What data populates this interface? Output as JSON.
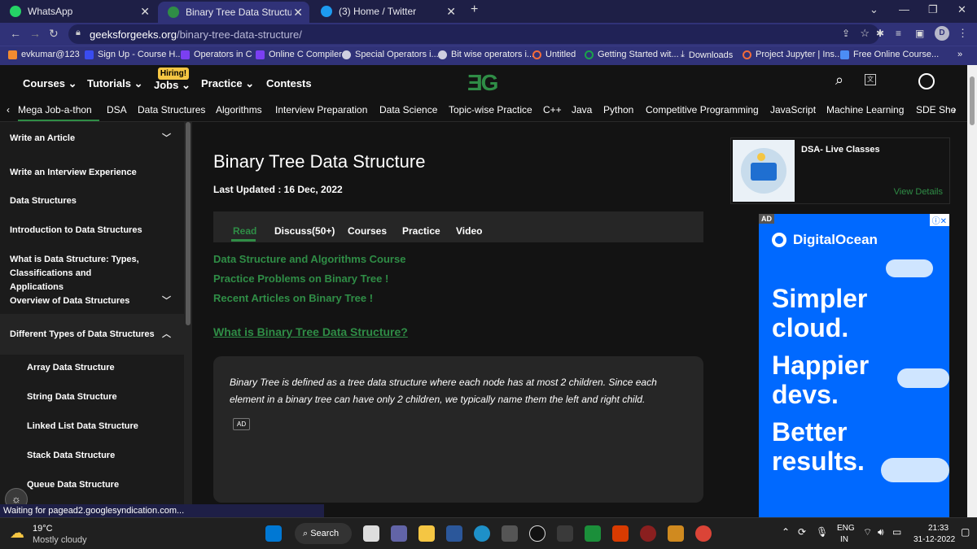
{
  "browser": {
    "tabs": [
      {
        "label": "WhatsApp",
        "color": "#25d366"
      },
      {
        "label": "Binary Tree Data Structure - GeeksforGeeks",
        "color": "#2f8d46"
      },
      {
        "label": "(3) Home / Twitter",
        "color": "#1d9bf0"
      }
    ],
    "url_host": "geeksforgeeks.org",
    "url_path": "/binary-tree-data-structure/",
    "bookmarks": [
      "evkumar@123",
      "Sign Up - Course H...",
      "Operators in C",
      "Online C Compiler",
      "Special Operators i...",
      "Bit wise operators i...",
      "Untitled",
      "Getting Started wit...",
      "Downloads",
      "Project Jupyter | Ins...",
      "Free Online Course..."
    ],
    "bookmarks_more": "»",
    "profile_initial": "D"
  },
  "header": {
    "nav": [
      "Courses",
      "Tutorials",
      "Jobs",
      "Practice",
      "Contests"
    ],
    "hiring_badge": "Hiring!",
    "logo": "ƎG",
    "subnav": [
      "Mega Job-a-thon",
      "DSA",
      "Data Structures",
      "Algorithms",
      "Interview Preparation",
      "Data Science",
      "Topic-wise Practice",
      "C++",
      "Java",
      "Python",
      "Competitive Programming",
      "JavaScript",
      "Machine Learning",
      "SDE She"
    ]
  },
  "sidebar": {
    "items": [
      {
        "label": "Write an Article",
        "chevron": "down"
      },
      {
        "label": "Write an Interview Experience"
      },
      {
        "label": "Data Structures"
      },
      {
        "label": "Introduction to Data Structures"
      },
      {
        "label": "What is Data Structure: Types, Classifications and Applications"
      },
      {
        "label": "Overview of Data Structures",
        "chevron": "down"
      },
      {
        "label": "Different Types of Data Structures",
        "chevron": "up"
      },
      {
        "label": "Array Data Structure"
      },
      {
        "label": "String Data Structure"
      },
      {
        "label": "Linked List Data Structure"
      },
      {
        "label": "Stack Data Structure"
      },
      {
        "label": "Queue Data Structure"
      }
    ]
  },
  "article": {
    "title": "Binary Tree Data Structure",
    "updated": "Last Updated : 16 Dec, 2022",
    "tabs": [
      "Read",
      "Discuss(50+)",
      "Courses",
      "Practice",
      "Video"
    ],
    "links": [
      "Data Structure and Algorithms Course",
      "Practice Problems on Binary Tree !",
      "Recent Articles on Binary Tree !"
    ],
    "heading": "What is Binary Tree Data Structure?",
    "body": "Binary Tree is defined as a tree data structure where each node has at most 2 children. Since each element in a binary tree can have only 2 children, we typically name them the left and right child.",
    "ad_label": "AD"
  },
  "right": {
    "dsa_title": "DSA- Live Classes",
    "dsa_link": "View Details",
    "ad_tag": "AD",
    "ad_brand": "DigitalOcean",
    "ad_lines": [
      "Simpler",
      "cloud.",
      "Happier",
      "devs.",
      "Better",
      "results."
    ]
  },
  "status": "Waiting for pagead2.googlesyndication.com...",
  "taskbar": {
    "temp": "19°C",
    "weather": "Mostly cloudy",
    "search": "Search",
    "lang1": "ENG",
    "lang2": "IN",
    "time": "21:33",
    "date": "31-12-2022"
  },
  "colors": {
    "accent": "#2f8d46",
    "chrome": "#303278",
    "ad": "#0069ff"
  }
}
